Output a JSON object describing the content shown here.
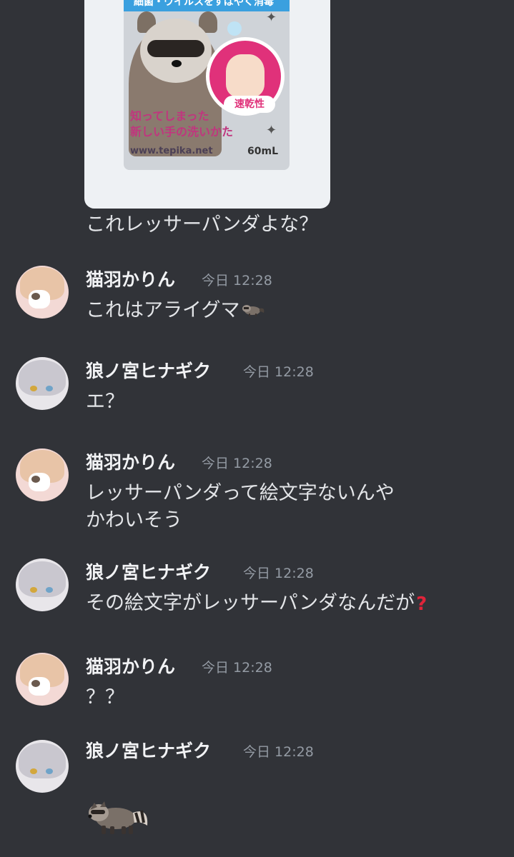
{
  "attachment": {
    "product_header": "細菌・ウイルスをすばやく消毒",
    "badge": "速乾性",
    "tagline_line1": "知ってしまった",
    "tagline_line2": "新しい手の洗いかた",
    "website": "www.tepika.net",
    "volume": "60mL",
    "caption": "これレッサーパンダよな？"
  },
  "messages": [
    {
      "user": "猫羽かりん",
      "time": "今日 12:28",
      "lines": [
        "これはアライグマ"
      ],
      "emoji": "raccoon-emoji-small"
    },
    {
      "user": "狼ノ宮ヒナギク",
      "time": "今日 12:28",
      "lines": [
        "エ？"
      ]
    },
    {
      "user": "猫羽かりん",
      "time": "今日 12:28",
      "lines": [
        "レッサーパンダって絵文字ないんや",
        "かわいそう"
      ]
    },
    {
      "user": "狼ノ宮ヒナギク",
      "time": "今日 12:28",
      "lines": [
        "その絵文字がレッサーパンダなんだが"
      ],
      "emoji": "red-question-mark-emoji"
    },
    {
      "user": "猫羽かりん",
      "time": "今日 12:28",
      "lines": [
        "？？"
      ]
    },
    {
      "user": "狼ノ宮ヒナギク",
      "time": "今日 12:28",
      "lines": [],
      "emoji": "raccoon-emoji-large"
    }
  ],
  "emoji_symbols": {
    "question": "?"
  },
  "colors": {
    "background": "#313338",
    "username": "#f2f3f5",
    "timestamp": "#949ba4",
    "text": "#e3e5e8"
  }
}
